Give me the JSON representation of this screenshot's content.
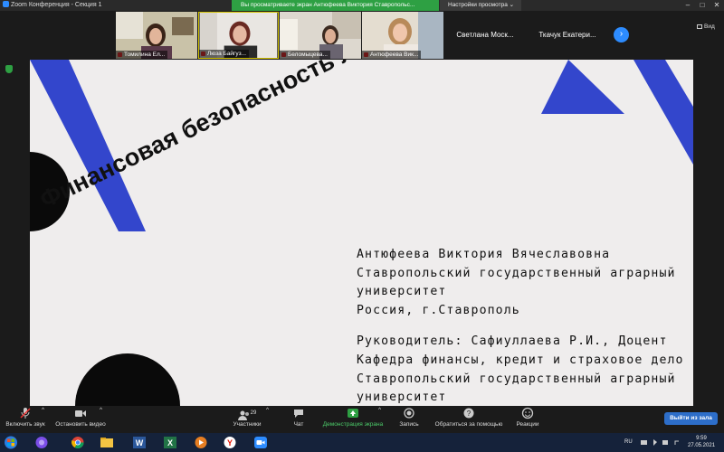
{
  "titlebar": {
    "title": "Zoom Конференция - Секция 1",
    "share_banner": "Вы просматриваете экран Антюфеева Виктория Ставропольс...",
    "view_options": "Настройки просмотра ⌄",
    "minimize": "–",
    "maximize": "□",
    "close": "✕"
  },
  "participants": {
    "videos": [
      {
        "name": "Томилина Ел..."
      },
      {
        "name": "Люза Байгуз..."
      },
      {
        "name": "Беломыцева..."
      },
      {
        "name": "Антюфеева Вик..."
      }
    ],
    "names_only": [
      {
        "name": "Светлана  Моск..."
      },
      {
        "name": "Ткачук  Екатери..."
      }
    ],
    "next_arrow": "›",
    "view_label": "Вид"
  },
  "slide": {
    "title": "Финансовая безопасность личности",
    "lines": [
      "Антюфеева Виктория Вячеславовна",
      "Ставропольский государственный аграрный",
      "университет",
      "Россия, г.Ставрополь",
      "",
      "Руководитель: Сафиуллаева Р.И., Доцент",
      "Кафедра финансы, кредит и страховое дело",
      "Ставропольский государственный аграрный",
      "университет"
    ],
    "colors": {
      "background": "#efeded",
      "accent": "#3346cc",
      "dark": "#0a0a0a"
    }
  },
  "toolbar": {
    "mute": {
      "label": "Включить звук",
      "icon": "mic-muted-icon"
    },
    "video": {
      "label": "Остановить видео",
      "icon": "video-icon"
    },
    "participants": {
      "label": "Участники",
      "count": "29",
      "icon": "participants-icon"
    },
    "chat": {
      "label": "Чат",
      "icon": "chat-icon"
    },
    "share": {
      "label": "Демонстрация экрана",
      "icon": "share-screen-icon"
    },
    "record": {
      "label": "Запись",
      "icon": "record-icon"
    },
    "help": {
      "label": "Обратиться за помощью",
      "icon": "help-icon"
    },
    "reactions": {
      "label": "Реакции",
      "icon": "reactions-icon"
    },
    "leave": "Выйти из зала",
    "caret": "^"
  },
  "taskbar": {
    "lang": "RU",
    "time": "9:59",
    "date": "27.05.2021"
  }
}
